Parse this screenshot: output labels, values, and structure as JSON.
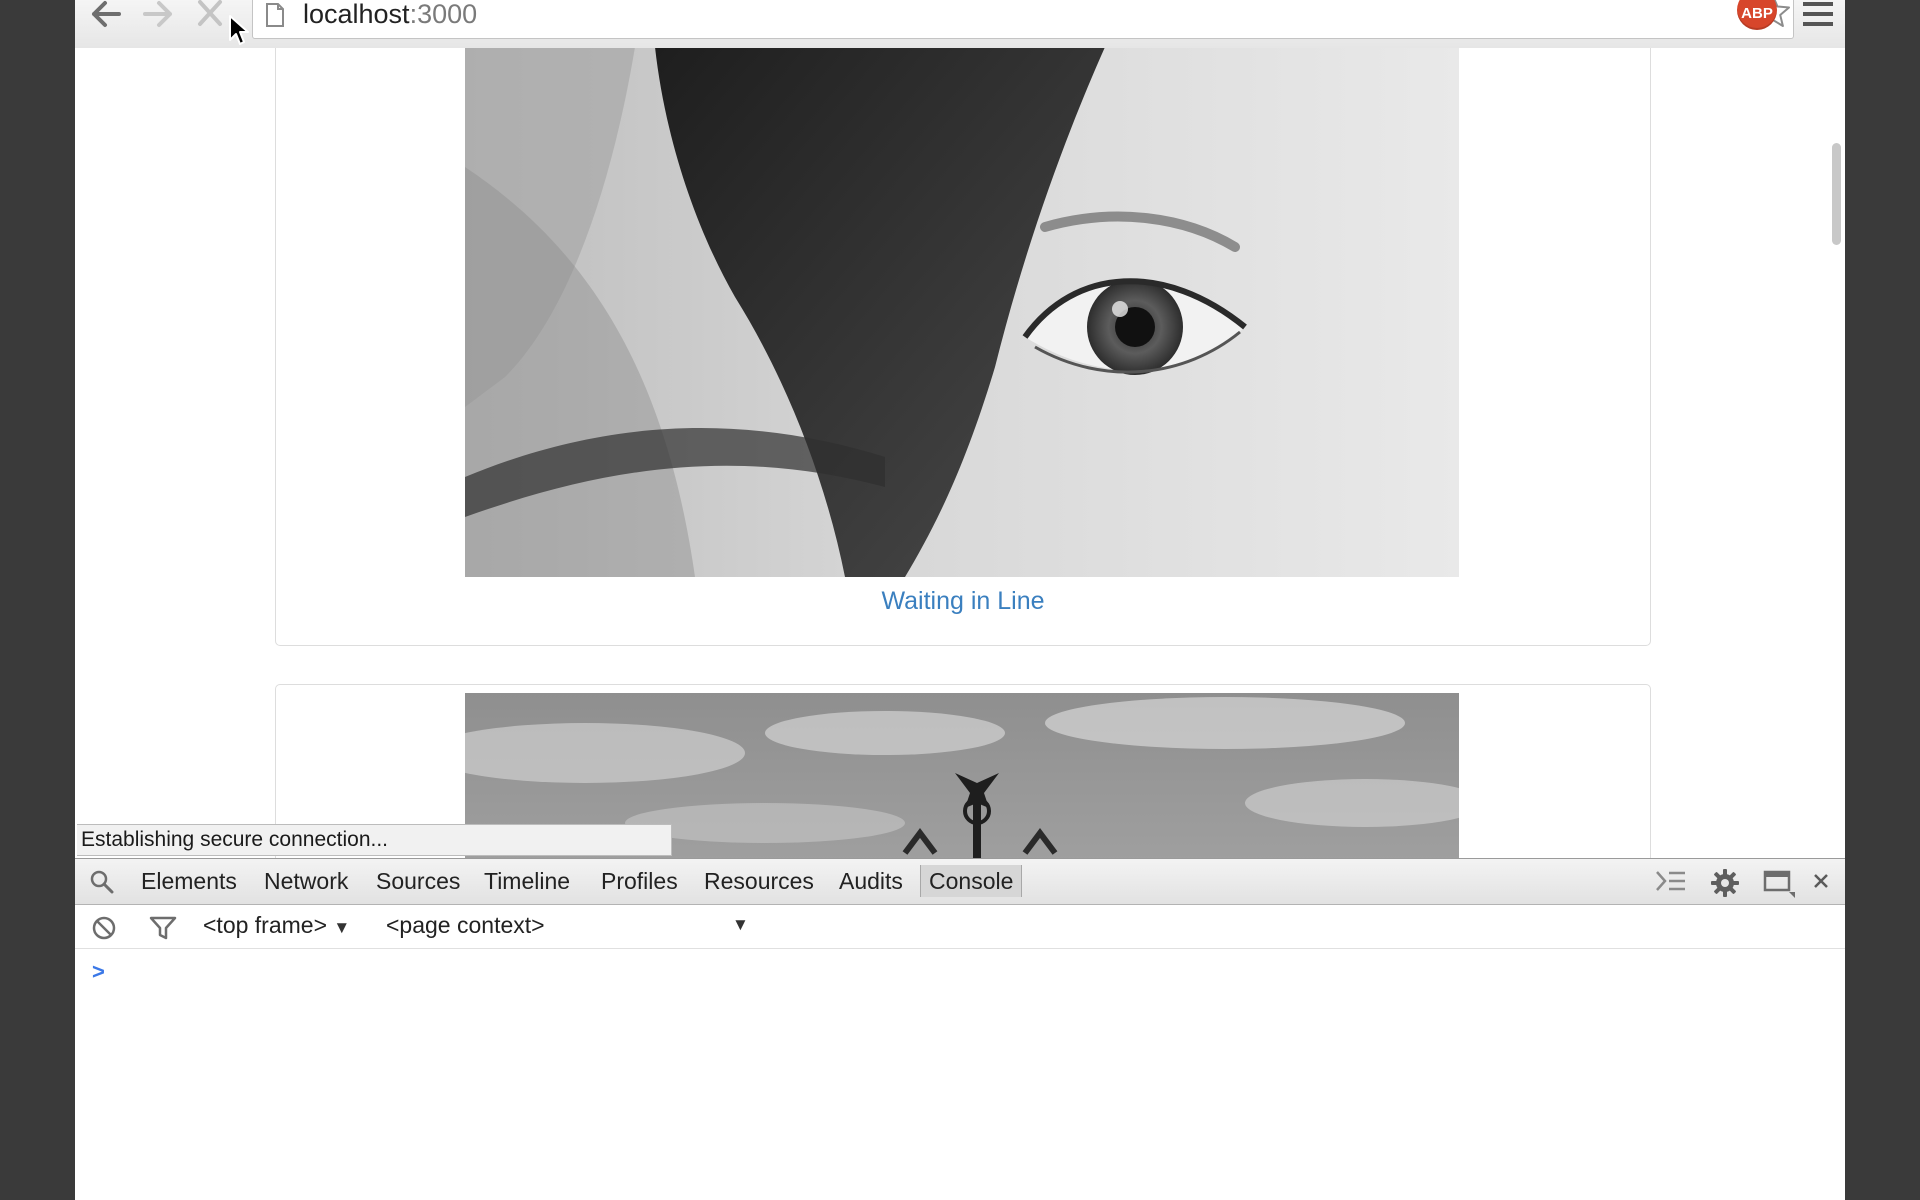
{
  "browser": {
    "url_host": "localhost",
    "url_port": ":3000",
    "back_icon": "arrow-left-icon",
    "forward_icon": "arrow-right-icon",
    "stop_icon": "close-icon",
    "bookmark_icon": "star-icon",
    "extension_label": "ABP",
    "menu_icon": "hamburger-menu-icon"
  },
  "page": {
    "cards": [
      {
        "caption": "Waiting in Line",
        "image": "black-and-white photo of an eye and hair"
      },
      {
        "caption": "",
        "image": "black-and-white photo of a statue against the sky"
      }
    ],
    "link_color": "#3a7fbf"
  },
  "status_bar": {
    "text": "Establishing secure connection..."
  },
  "devtools": {
    "tabs": [
      "Elements",
      "Network",
      "Sources",
      "Timeline",
      "Profiles",
      "Resources",
      "Audits",
      "Console"
    ],
    "active_tab": "Console",
    "frame_select": "<top frame>",
    "context_select": "<page context>",
    "prompt": ">"
  }
}
